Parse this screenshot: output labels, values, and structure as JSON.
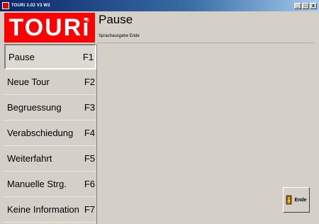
{
  "window": {
    "title": "TOURi 3.02 V3 W2",
    "min_glyph": "_",
    "max_glyph": "□",
    "close_glyph": "x"
  },
  "logo": {
    "text": "TOURi",
    "mark": "®"
  },
  "header": {
    "title": "Pause",
    "subtitle": "Sprachausgabe Ende"
  },
  "menu": [
    {
      "label": "Pause",
      "key": "F1",
      "active": true
    },
    {
      "label": "Neue Tour",
      "key": "F2"
    },
    {
      "label": "Begruessung",
      "key": "F3"
    },
    {
      "label": "Verabschiedung",
      "key": "F4"
    },
    {
      "label": "Weiterfahrt",
      "key": "F5"
    },
    {
      "label": "Manuelle Strg.",
      "key": "F6"
    },
    {
      "label": "Keine Information",
      "key": "F7"
    }
  ],
  "ende_button": {
    "label": "Ende",
    "icon": "exit-door-icon"
  },
  "colors": {
    "brand": "#ff0000",
    "background": "#d4d0c8"
  }
}
